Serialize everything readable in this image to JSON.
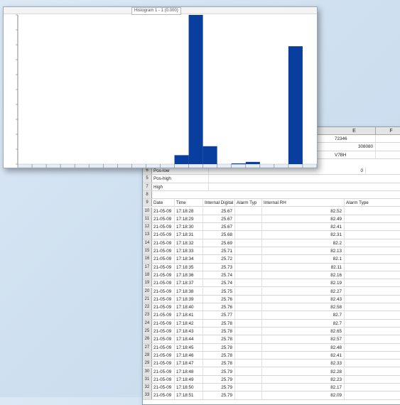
{
  "sheet": {
    "col_headers": [
      "E",
      "F"
    ],
    "top_cells": [
      "72346",
      "308080",
      "V7BH"
    ],
    "labels": [
      "Pos-low",
      "Pos-high",
      "High"
    ],
    "label_value": "0",
    "header": [
      "Date",
      "Time",
      "Internal Digital Te",
      "Alarm Typ",
      "Internal RH",
      "Alarm Type"
    ],
    "rows": [
      {
        "rn": "10",
        "date": "21-05-09",
        "time": "17:18:28",
        "temp": "25.67",
        "rh": "82.52"
      },
      {
        "rn": "11",
        "date": "21-05-09",
        "time": "17:18:29",
        "temp": "25.67",
        "rh": "82.49"
      },
      {
        "rn": "12",
        "date": "21-05-09",
        "time": "17:18:30",
        "temp": "25.67",
        "rh": "82.41"
      },
      {
        "rn": "13",
        "date": "21-05-09",
        "time": "17:18:31",
        "temp": "25.68",
        "rh": "82.31"
      },
      {
        "rn": "14",
        "date": "21-05-09",
        "time": "17:18:32",
        "temp": "25.69",
        "rh": "82.2"
      },
      {
        "rn": "15",
        "date": "21-05-09",
        "time": "17:18:33",
        "temp": "25.71",
        "rh": "82.13"
      },
      {
        "rn": "16",
        "date": "21-05-09",
        "time": "17:18:34",
        "temp": "25.72",
        "rh": "82.1"
      },
      {
        "rn": "17",
        "date": "21-05-09",
        "time": "17:18:35",
        "temp": "25.73",
        "rh": "82.11"
      },
      {
        "rn": "18",
        "date": "21-05-09",
        "time": "17:18:36",
        "temp": "25.74",
        "rh": "82.16"
      },
      {
        "rn": "19",
        "date": "21-05-09",
        "time": "17:18:37",
        "temp": "25.74",
        "rh": "82.19"
      },
      {
        "rn": "20",
        "date": "21-05-09",
        "time": "17:18:38",
        "temp": "25.75",
        "rh": "82.27"
      },
      {
        "rn": "21",
        "date": "21-05-09",
        "time": "17:18:39",
        "temp": "25.76",
        "rh": "82.43"
      },
      {
        "rn": "22",
        "date": "21-05-09",
        "time": "17:18:40",
        "temp": "25.76",
        "rh": "82.58"
      },
      {
        "rn": "23",
        "date": "21-05-09",
        "time": "17:18:41",
        "temp": "25.77",
        "rh": "82.7"
      },
      {
        "rn": "24",
        "date": "21-05-09",
        "time": "17:18:42",
        "temp": "25.78",
        "rh": "82.7"
      },
      {
        "rn": "25",
        "date": "21-05-09",
        "time": "17:18:43",
        "temp": "25.78",
        "rh": "82.65"
      },
      {
        "rn": "26",
        "date": "21-05-09",
        "time": "17:18:44",
        "temp": "25.78",
        "rh": "82.57"
      },
      {
        "rn": "27",
        "date": "21-05-09",
        "time": "17:18:45",
        "temp": "25.78",
        "rh": "82.48"
      },
      {
        "rn": "28",
        "date": "21-05-09",
        "time": "17:18:46",
        "temp": "25.78",
        "rh": "82.41"
      },
      {
        "rn": "29",
        "date": "21-05-09",
        "time": "17:18:47",
        "temp": "25.78",
        "rh": "82.33"
      },
      {
        "rn": "30",
        "date": "21-05-09",
        "time": "17:18:48",
        "temp": "25.79",
        "rh": "82.28"
      },
      {
        "rn": "31",
        "date": "21-05-09",
        "time": "17:18:49",
        "temp": "25.79",
        "rh": "82.23"
      },
      {
        "rn": "32",
        "date": "21-05-09",
        "time": "17:18:50",
        "temp": "25.79",
        "rh": "82.17"
      },
      {
        "rn": "33",
        "date": "21-05-09",
        "time": "17:18:51",
        "temp": "25.79",
        "rh": "82.09"
      }
    ]
  },
  "chart": {
    "title": "Histogram 1 - 1 (0.000)",
    "bar_color": "#0a3e9e",
    "bins": [
      0,
      0,
      0,
      0,
      0,
      0,
      0,
      0,
      0,
      0,
      0,
      0.06,
      1.0,
      0.12,
      0,
      0.005,
      0.015,
      0,
      0,
      0.79,
      0
    ]
  }
}
